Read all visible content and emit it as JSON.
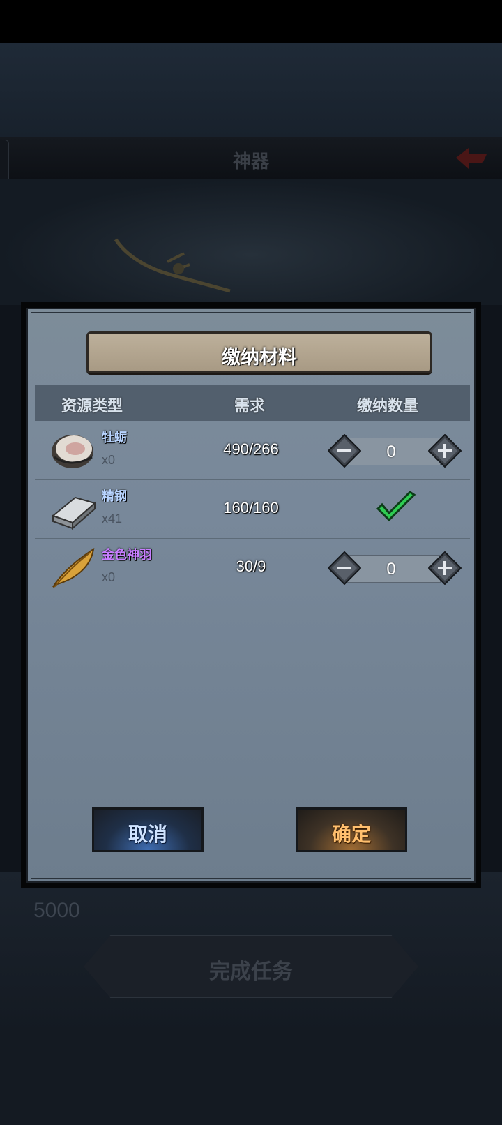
{
  "background": {
    "title": "神器",
    "reward_value": "5000",
    "complete_button": "完成任务"
  },
  "dialog": {
    "title": "缴纳材料",
    "columns": {
      "type": "资源类型",
      "requirement": "需求",
      "quantity": "缴纳数量"
    },
    "items": [
      {
        "name": "牡蛎",
        "name_color": "#b8d4ff",
        "count": "x0",
        "requirement": "490/266",
        "quantity": "0",
        "icon": "oyster-icon",
        "completed": false
      },
      {
        "name": "精钢",
        "name_color": "#b8d4ff",
        "count": "x41",
        "requirement": "160/160",
        "icon": "steel-ingot-icon",
        "completed": true
      },
      {
        "name": "金色神羽",
        "name_color": "#c77dff",
        "count": "x0",
        "requirement": "30/9",
        "quantity": "0",
        "icon": "golden-feather-icon",
        "completed": false
      }
    ],
    "cancel_label": "取消",
    "confirm_label": "确定"
  }
}
